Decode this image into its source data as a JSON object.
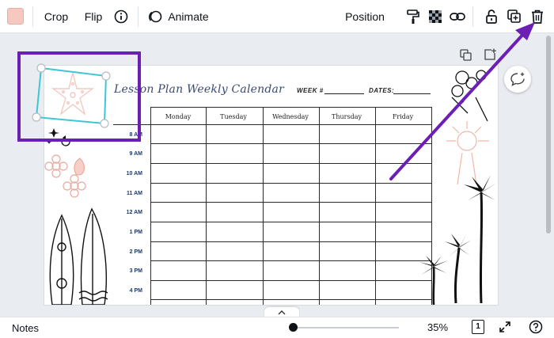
{
  "toolbar": {
    "color_swatch": "#f7c8c0",
    "crop_label": "Crop",
    "flip_label": "Flip",
    "info_icon": "info-icon",
    "animate_label": "Animate",
    "position_label": "Position",
    "icons": [
      "paint-roller-icon",
      "transparency-icon",
      "link-icon",
      "lock-icon",
      "duplicate-icon",
      "trash-icon"
    ]
  },
  "calendar": {
    "title": "Lesson Plan Weekly Calendar",
    "week_label": "WEEK #",
    "dates_label": "DATES:",
    "days": [
      "Monday",
      "Tuesday",
      "Wednesday",
      "Thursday",
      "Friday"
    ],
    "times": [
      "8 AM",
      "9 AM",
      "10 AM",
      "11 AM",
      "12 AM",
      "1 PM",
      "2 PM",
      "3 PM",
      "4 PM"
    ]
  },
  "colors": {
    "accent_purple": "#6c1fb5",
    "selection_teal": "#3ec6d1"
  },
  "bottombar": {
    "notes_label": "Notes",
    "zoom_value": "35%",
    "zoom_fraction": 0.03,
    "page_count": "1"
  }
}
